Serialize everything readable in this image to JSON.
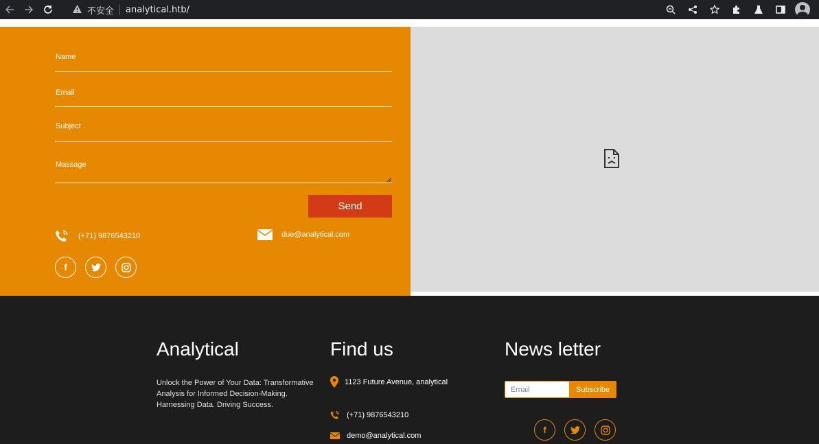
{
  "browser": {
    "security_label": "不安全",
    "url": "analytical.htb/"
  },
  "contact_form": {
    "name_placeholder": "Name",
    "email_placeholder": "Email",
    "subject_placeholder": "Subject",
    "message_placeholder": "Massage",
    "send_label": "Send",
    "phone": "(+71) 9876543210",
    "email": "due@analytical.com"
  },
  "footer": {
    "brand": {
      "title": "Analytical",
      "description": "Unlock the Power of Your Data: Transformative Analysis for Informed Decision-Making. Harnessing Data. Driving Success."
    },
    "find_us": {
      "title": "Find us",
      "address": "1123 Future Avenue, analytical",
      "phone": "(+71) 9876543210",
      "email": "demo@analytical.com"
    },
    "newsletter": {
      "title": "News letter",
      "email_placeholder": "Email",
      "subscribe_label": "Subscribe"
    }
  },
  "colors": {
    "accent": "#e68801",
    "send_button": "#d33a16",
    "footer_bg": "#1d1d1d"
  }
}
